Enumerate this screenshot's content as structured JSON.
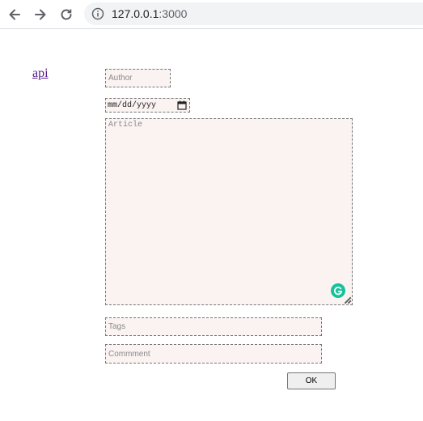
{
  "browser": {
    "url_host": "127.0.0.1",
    "url_port": ":3000",
    "icons": [
      "back-arrow-icon",
      "forward-arrow-icon",
      "reload-icon",
      "info-icon"
    ]
  },
  "page": {
    "link_label": "api",
    "form": {
      "author_placeholder": "Author",
      "date_display": "mm/dd/yyyy",
      "article_placeholder": "Article",
      "tags_placeholder": "Tags",
      "comment_placeholder": "Commment",
      "ok_label": "OK"
    }
  },
  "colors": {
    "field_background": "#fbf2f2",
    "link": "#551a8b",
    "grammarly": "#15c39a"
  }
}
